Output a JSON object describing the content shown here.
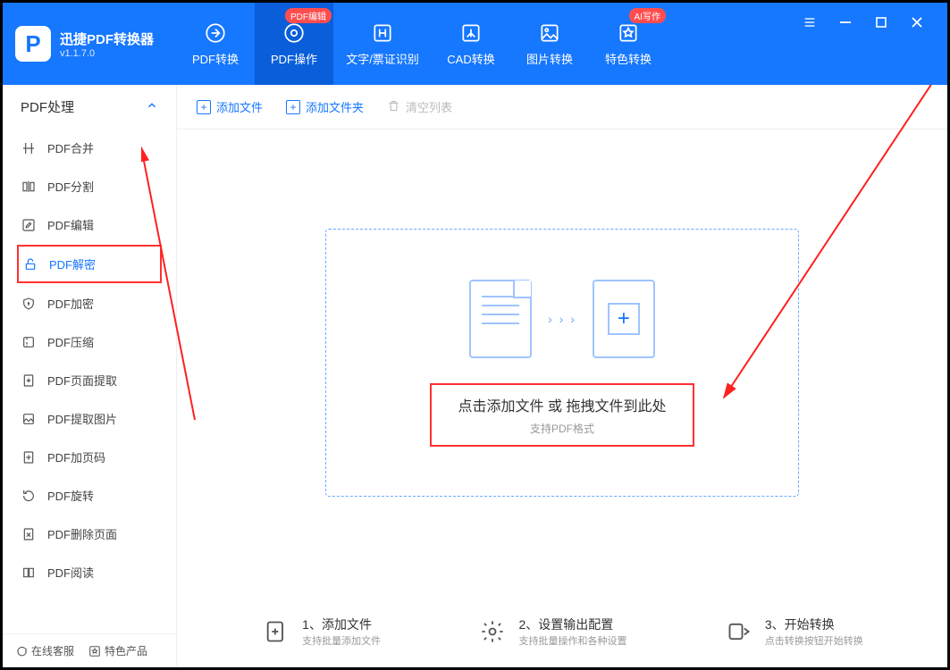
{
  "app": {
    "title": "迅捷PDF转换器",
    "version": "v1.1.7.0"
  },
  "header_tabs": [
    {
      "label": "PDF转换",
      "badge": null
    },
    {
      "label": "PDF操作",
      "badge": "PDF编辑",
      "active": true
    },
    {
      "label": "文字/票证识别",
      "badge": null
    },
    {
      "label": "CAD转换",
      "badge": null
    },
    {
      "label": "图片转换",
      "badge": null
    },
    {
      "label": "特色转换",
      "badge": "AI写作"
    }
  ],
  "sidebar": {
    "section_title": "PDF处理",
    "items": [
      {
        "label": "PDF合并"
      },
      {
        "label": "PDF分割"
      },
      {
        "label": "PDF编辑"
      },
      {
        "label": "PDF解密",
        "selected": true
      },
      {
        "label": "PDF加密"
      },
      {
        "label": "PDF压缩"
      },
      {
        "label": "PDF页面提取"
      },
      {
        "label": "PDF提取图片"
      },
      {
        "label": "PDF加页码"
      },
      {
        "label": "PDF旋转"
      },
      {
        "label": "PDF删除页面"
      },
      {
        "label": "PDF阅读"
      }
    ],
    "footer": {
      "support": "在线客服",
      "featured": "特色产品"
    }
  },
  "toolbar": {
    "add_file": "添加文件",
    "add_folder": "添加文件夹",
    "clear_list": "清空列表"
  },
  "dropzone": {
    "text1": "点击添加文件 或 拖拽文件到此处",
    "text2": "支持PDF格式"
  },
  "steps": [
    {
      "title": "1、添加文件",
      "sub": "支持批量添加文件"
    },
    {
      "title": "2、设置输出配置",
      "sub": "支持批量操作和各种设置"
    },
    {
      "title": "3、开始转换",
      "sub": "点击转换按钮开始转换"
    }
  ]
}
